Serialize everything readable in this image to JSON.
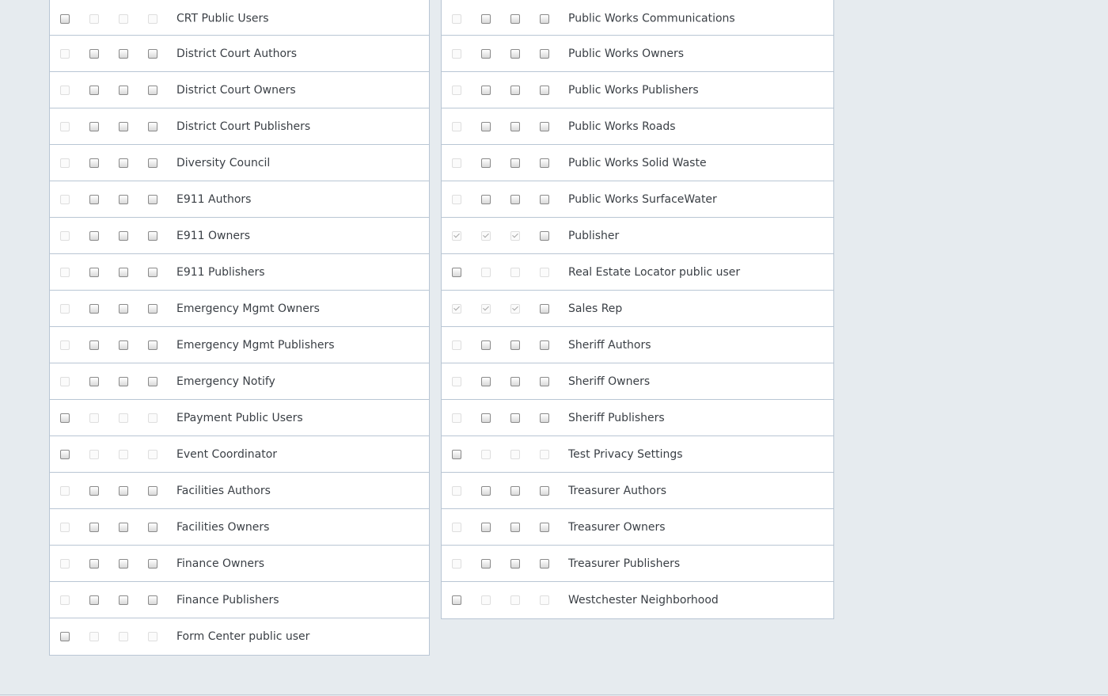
{
  "left_groups": [
    {
      "label": "CRT Public Users",
      "cols": [
        "on",
        "off",
        "off",
        "off"
      ]
    },
    {
      "label": "District Court Authors",
      "cols": [
        "off",
        "on",
        "on",
        "on"
      ]
    },
    {
      "label": "District Court Owners",
      "cols": [
        "off",
        "on",
        "on",
        "on"
      ]
    },
    {
      "label": "District Court Publishers",
      "cols": [
        "off",
        "on",
        "on",
        "on"
      ]
    },
    {
      "label": "Diversity Council",
      "cols": [
        "off",
        "on",
        "on",
        "on"
      ]
    },
    {
      "label": "E911 Authors",
      "cols": [
        "off",
        "on",
        "on",
        "on"
      ]
    },
    {
      "label": "E911 Owners",
      "cols": [
        "off",
        "on",
        "on",
        "on"
      ]
    },
    {
      "label": "E911 Publishers",
      "cols": [
        "off",
        "on",
        "on",
        "on"
      ]
    },
    {
      "label": "Emergency Mgmt Owners",
      "cols": [
        "off",
        "on",
        "on",
        "on"
      ]
    },
    {
      "label": "Emergency Mgmt Publishers",
      "cols": [
        "off",
        "on",
        "on",
        "on"
      ]
    },
    {
      "label": "Emergency Notify",
      "cols": [
        "off",
        "on",
        "on",
        "on"
      ]
    },
    {
      "label": "EPayment Public Users",
      "cols": [
        "on",
        "off",
        "off",
        "off"
      ]
    },
    {
      "label": "Event Coordinator",
      "cols": [
        "on",
        "off",
        "off",
        "off"
      ]
    },
    {
      "label": "Facilities Authors",
      "cols": [
        "off",
        "on",
        "on",
        "on"
      ]
    },
    {
      "label": "Facilities Owners",
      "cols": [
        "off",
        "on",
        "on",
        "on"
      ]
    },
    {
      "label": "Finance Owners",
      "cols": [
        "off",
        "on",
        "on",
        "on"
      ]
    },
    {
      "label": "Finance Publishers",
      "cols": [
        "off",
        "on",
        "on",
        "on"
      ]
    },
    {
      "label": "Form Center public user",
      "cols": [
        "on",
        "off",
        "off",
        "off"
      ]
    }
  ],
  "right_groups": [
    {
      "label": "Public Works Communications",
      "cols": [
        "off",
        "on",
        "on",
        "on"
      ]
    },
    {
      "label": "Public Works Owners",
      "cols": [
        "off",
        "on",
        "on",
        "on"
      ]
    },
    {
      "label": "Public Works Publishers",
      "cols": [
        "off",
        "on",
        "on",
        "on"
      ]
    },
    {
      "label": "Public Works Roads",
      "cols": [
        "off",
        "on",
        "on",
        "on"
      ]
    },
    {
      "label": "Public Works Solid Waste",
      "cols": [
        "off",
        "on",
        "on",
        "on"
      ]
    },
    {
      "label": "Public Works SurfaceWater",
      "cols": [
        "off",
        "on",
        "on",
        "on"
      ]
    },
    {
      "label": "Publisher",
      "cols": [
        "checked",
        "checked",
        "checked",
        "on"
      ]
    },
    {
      "label": "Real Estate Locator public user",
      "cols": [
        "on",
        "off",
        "off",
        "off"
      ]
    },
    {
      "label": "Sales Rep",
      "cols": [
        "checked",
        "checked",
        "checked",
        "on"
      ]
    },
    {
      "label": "Sheriff Authors",
      "cols": [
        "off",
        "on",
        "on",
        "on"
      ]
    },
    {
      "label": "Sheriff Owners",
      "cols": [
        "off",
        "on",
        "on",
        "on"
      ]
    },
    {
      "label": "Sheriff Publishers",
      "cols": [
        "off",
        "on",
        "on",
        "on"
      ]
    },
    {
      "label": "Test Privacy Settings",
      "cols": [
        "on",
        "off",
        "off",
        "off"
      ]
    },
    {
      "label": "Treasurer Authors",
      "cols": [
        "off",
        "on",
        "on",
        "on"
      ]
    },
    {
      "label": "Treasurer Owners",
      "cols": [
        "off",
        "on",
        "on",
        "on"
      ]
    },
    {
      "label": "Treasurer Publishers",
      "cols": [
        "off",
        "on",
        "on",
        "on"
      ]
    },
    {
      "label": "Westchester Neighborhood",
      "cols": [
        "on",
        "off",
        "off",
        "off"
      ]
    }
  ]
}
